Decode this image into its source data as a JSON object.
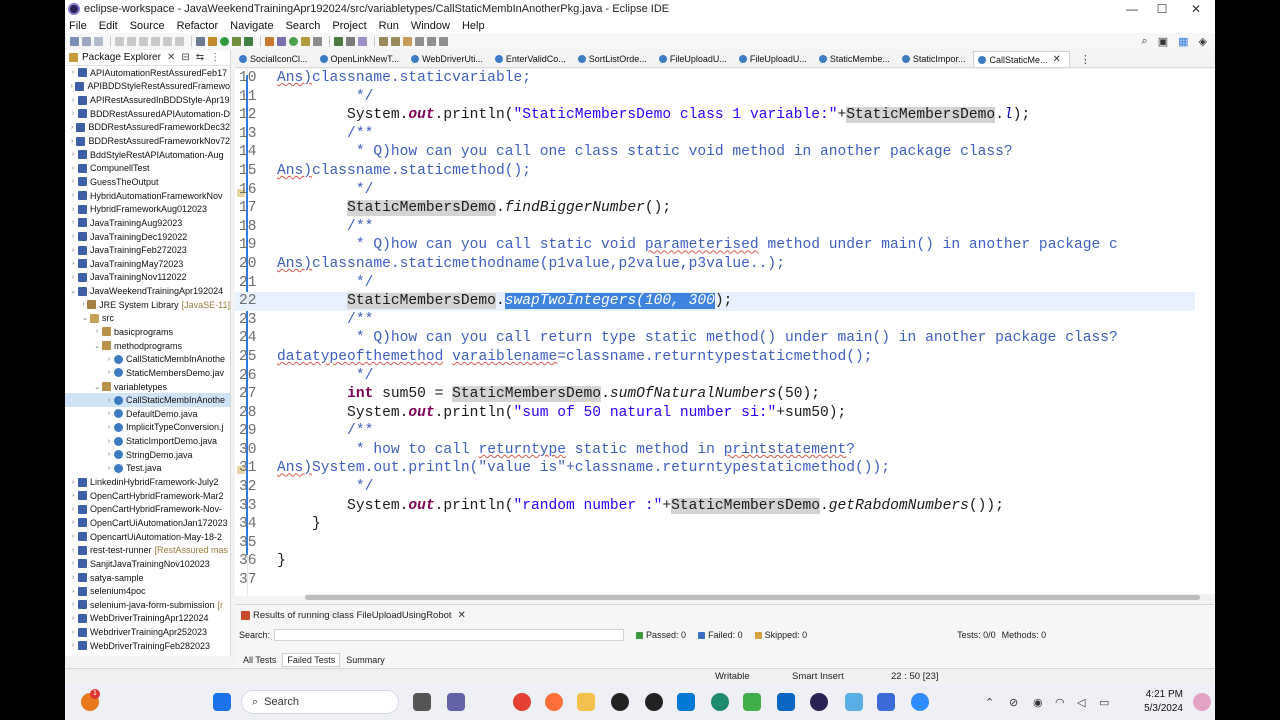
{
  "window": {
    "title": "eclipse-workspace - JavaWeekendTrainingApr192024/src/variabletypes/CallStaticMembInAnotherPkg.java - Eclipse IDE",
    "minimize": "—",
    "maximize": "☐",
    "close": "✕"
  },
  "menu": [
    "File",
    "Edit",
    "Source",
    "Refactor",
    "Navigate",
    "Search",
    "Project",
    "Run",
    "Window",
    "Help"
  ],
  "package_explorer": {
    "title": "Package Explorer",
    "items": [
      {
        "label": "APIAutomationRestAssuredFeb17",
        "type": "proj",
        "level": 0,
        "arrow": "›"
      },
      {
        "label": "APIBDDStyleRestAssuredFramewo",
        "type": "proj",
        "level": 0,
        "arrow": "›"
      },
      {
        "label": "APIRestAssuredInBDDStyle-Apr19",
        "type": "proj",
        "level": 0,
        "arrow": "›"
      },
      {
        "label": "BDDRestAssuredAPIAutomation-D",
        "type": "proj",
        "level": 0,
        "arrow": "›"
      },
      {
        "label": "BDDRestAssuredFrameworkDec32",
        "type": "proj",
        "level": 0,
        "arrow": "›"
      },
      {
        "label": "BDDRestAssuredFrameworkNov72",
        "type": "proj",
        "level": 0,
        "arrow": "›"
      },
      {
        "label": "BddStyleRestAPIAutomation-Aug",
        "type": "proj",
        "level": 0,
        "arrow": "›"
      },
      {
        "label": "CompunellTest",
        "type": "proj",
        "level": 0,
        "arrow": "›"
      },
      {
        "label": "GuessTheOutput",
        "type": "proj",
        "level": 0,
        "arrow": "›"
      },
      {
        "label": "HybridAutomationFrameworkNov",
        "type": "proj",
        "level": 0,
        "arrow": "›"
      },
      {
        "label": "HybridFrameworkAug012023",
        "type": "proj",
        "level": 0,
        "arrow": "›"
      },
      {
        "label": "JavaTrainingAug92023",
        "type": "proj",
        "level": 0,
        "arrow": "›"
      },
      {
        "label": "JavaTrainingDec192022",
        "type": "proj",
        "level": 0,
        "arrow": "›"
      },
      {
        "label": "JavaTrainingFeb272023",
        "type": "proj",
        "level": 0,
        "arrow": "›"
      },
      {
        "label": "JavaTrainingMay72023",
        "type": "proj",
        "level": 0,
        "arrow": "›"
      },
      {
        "label": "JavaTrainingNov112022",
        "type": "proj",
        "level": 0,
        "arrow": "›"
      },
      {
        "label": "JavaWeekendTrainingApr192024",
        "type": "proj",
        "level": 0,
        "arrow": "⌄"
      },
      {
        "label": "JRE System Library",
        "extra": "[JavaSE-11]",
        "type": "lib",
        "level": 1,
        "arrow": "›"
      },
      {
        "label": "src",
        "type": "src",
        "level": 1,
        "arrow": "⌄"
      },
      {
        "label": "basicprograms",
        "type": "pkg",
        "level": 2,
        "arrow": "›"
      },
      {
        "label": "methodprograms",
        "type": "pkg",
        "level": 2,
        "arrow": "⌄"
      },
      {
        "label": "CallStaticMembInAnothe",
        "type": "java",
        "level": 3,
        "arrow": "›"
      },
      {
        "label": "StaticMembersDemo.jav",
        "type": "java",
        "level": 3,
        "arrow": "›"
      },
      {
        "label": "variabletypes",
        "type": "pkg",
        "level": 2,
        "arrow": "⌄"
      },
      {
        "label": "CallStaticMembInAnothe",
        "type": "java",
        "level": 3,
        "arrow": "›",
        "selected": true
      },
      {
        "label": "DefaultDemo.java",
        "type": "java",
        "level": 3,
        "arrow": "›"
      },
      {
        "label": "ImplicitTypeConversion.j",
        "type": "java",
        "level": 3,
        "arrow": "›"
      },
      {
        "label": "StaticImportDemo.java",
        "type": "java",
        "level": 3,
        "arrow": "›"
      },
      {
        "label": "StringDemo.java",
        "type": "java",
        "level": 3,
        "arrow": "›"
      },
      {
        "label": "Test.java",
        "type": "java",
        "level": 3,
        "arrow": "›"
      },
      {
        "label": "LinkedinHybridFramework-July2",
        "type": "proj",
        "level": 0,
        "arrow": "›"
      },
      {
        "label": "OpenCartHybridFramework-Mar2",
        "type": "proj",
        "level": 0,
        "arrow": "›"
      },
      {
        "label": "OpenCartHybridFramework-Nov-",
        "type": "proj",
        "level": 0,
        "arrow": "›"
      },
      {
        "label": "OpenCartUiAutomationJan172023",
        "type": "proj",
        "level": 0,
        "arrow": "›"
      },
      {
        "label": "OpencartUiAutomation-May-18-2",
        "type": "proj",
        "level": 0,
        "arrow": "›"
      },
      {
        "label": "rest-test-runner",
        "extra": "[RestAssured mas",
        "type": "proj",
        "level": 0,
        "arrow": "›"
      },
      {
        "label": "SanjitJavaTrainingNov102023",
        "type": "proj",
        "level": 0,
        "arrow": "›"
      },
      {
        "label": "satya-sample",
        "type": "proj",
        "level": 0,
        "arrow": "›"
      },
      {
        "label": "selenium4poc",
        "type": "proj",
        "level": 0,
        "arrow": "›"
      },
      {
        "label": "selenium-java-form-submission",
        "extra": "[r",
        "type": "proj",
        "level": 0,
        "arrow": "›"
      },
      {
        "label": "WebDriverTrainingApr122024",
        "type": "proj",
        "level": 0,
        "arrow": "›"
      },
      {
        "label": "WebdriverTrainingApr252023",
        "type": "proj",
        "level": 0,
        "arrow": "›"
      },
      {
        "label": "WebDriverTrainingFeb282023",
        "type": "proj",
        "level": 0,
        "arrow": "›"
      }
    ]
  },
  "editor_tabs": [
    {
      "label": "SocialIconCl..."
    },
    {
      "label": "OpenLinkNewT..."
    },
    {
      "label": "WebDriverUti..."
    },
    {
      "label": "EnterValidCo..."
    },
    {
      "label": "SortListOrde..."
    },
    {
      "label": "FileUploadU..."
    },
    {
      "label": "FileUploadU..."
    },
    {
      "label": "StaticMembe..."
    },
    {
      "label": "StaticImpor..."
    },
    {
      "label": "CallStaticMe...",
      "active": true
    }
  ],
  "code_lines": [
    {
      "n": "10",
      "segs": [
        [
          "Ans)",
          "cm sq"
        ],
        [
          "classname.staticvariable;",
          "cm"
        ]
      ]
    },
    {
      "n": "11",
      "segs": [
        [
          "         */",
          "cm"
        ]
      ]
    },
    {
      "n": "12",
      "segs": [
        [
          "        System.",
          ""
        ],
        [
          "out",
          "kw it"
        ],
        [
          ".println(",
          ""
        ],
        [
          "\"StaticMembersDemo class 1 variable:\"",
          "st"
        ],
        [
          "+",
          ""
        ],
        [
          "StaticMembersDemo",
          "occ"
        ],
        [
          ".",
          ""
        ],
        [
          "l",
          "cn"
        ],
        [
          ");",
          ""
        ]
      ]
    },
    {
      "n": "13",
      "segs": [
        [
          "        /**",
          "cm"
        ]
      ]
    },
    {
      "n": "14",
      "segs": [
        [
          "         * Q)how can you call one class static void method in another package class?",
          "cm"
        ]
      ]
    },
    {
      "n": "15",
      "segs": [
        [
          "Ans)",
          "cm sq"
        ],
        [
          "classname.staticmethod();",
          "cm"
        ]
      ]
    },
    {
      "n": "16",
      "segs": [
        [
          "         */",
          "cm"
        ]
      ]
    },
    {
      "n": "17",
      "segs": [
        [
          "        ",
          ""
        ],
        [
          "StaticMembersDemo",
          "occ"
        ],
        [
          ".",
          ""
        ],
        [
          "findBiggerNumber",
          "it"
        ],
        [
          "();",
          ""
        ]
      ]
    },
    {
      "n": "18",
      "segs": [
        [
          "        /**",
          "cm"
        ]
      ]
    },
    {
      "n": "19",
      "segs": [
        [
          "         * Q)how can you call static void ",
          "cm"
        ],
        [
          "parameterised",
          "cm sq"
        ],
        [
          " method under main() in another package c",
          "cm"
        ]
      ]
    },
    {
      "n": "20",
      "segs": [
        [
          "Ans)",
          "cm sq"
        ],
        [
          "classname.staticmethodname(p1value,p2value,p3value..);",
          "cm"
        ]
      ]
    },
    {
      "n": "21",
      "segs": [
        [
          "         */",
          "cm"
        ]
      ]
    },
    {
      "n": "22",
      "cur": true,
      "segs": [
        [
          "        ",
          ""
        ],
        [
          "StaticMembersDemo",
          "occ"
        ],
        [
          ".",
          ""
        ],
        [
          "swapTwoIntegers(100, 300",
          "selt"
        ],
        [
          ");",
          ""
        ]
      ]
    },
    {
      "n": "23",
      "segs": [
        [
          "        /**",
          "cm"
        ]
      ]
    },
    {
      "n": "24",
      "segs": [
        [
          "         * Q)how can you call return type static method() under main() in another package class?",
          "cm"
        ]
      ]
    },
    {
      "n": "25",
      "segs": [
        [
          "datatypeofthemethod",
          "cm sq"
        ],
        [
          " ",
          "cm"
        ],
        [
          "varaiblename",
          "cm sq"
        ],
        [
          "=classname.returntypestaticmethod();",
          "cm"
        ]
      ]
    },
    {
      "n": "26",
      "segs": [
        [
          "         */",
          "cm"
        ]
      ]
    },
    {
      "n": "27",
      "segs": [
        [
          "        ",
          ""
        ],
        [
          "int",
          "kw"
        ],
        [
          " sum50 = ",
          ""
        ],
        [
          "StaticMembersDemo",
          "occ"
        ],
        [
          ".",
          ""
        ],
        [
          "sumOfNaturalNumbers",
          "it"
        ],
        [
          "(50);",
          ""
        ]
      ]
    },
    {
      "n": "28",
      "segs": [
        [
          "        System.",
          ""
        ],
        [
          "out",
          "kw it"
        ],
        [
          ".println(",
          ""
        ],
        [
          "\"sum of 50 natural number si:\"",
          "st"
        ],
        [
          "+sum50);",
          ""
        ]
      ]
    },
    {
      "n": "29",
      "segs": [
        [
          "        /**",
          "cm"
        ]
      ]
    },
    {
      "n": "30",
      "segs": [
        [
          "         * how to call ",
          "cm"
        ],
        [
          "returntype",
          "cm sq"
        ],
        [
          " static method in ",
          "cm"
        ],
        [
          "printstatement",
          "cm sq"
        ],
        [
          "?",
          "cm"
        ]
      ]
    },
    {
      "n": "31",
      "segs": [
        [
          "Ans)",
          "cm sq"
        ],
        [
          "System.out.println(\"value is\"+classname.returntypestaticmethod());",
          "cm"
        ]
      ]
    },
    {
      "n": "32",
      "segs": [
        [
          "         */",
          "cm"
        ]
      ]
    },
    {
      "n": "33",
      "segs": [
        [
          "        System.",
          ""
        ],
        [
          "out",
          "kw it"
        ],
        [
          ".println(",
          ""
        ],
        [
          "\"random number :\"",
          "st"
        ],
        [
          "+",
          ""
        ],
        [
          "StaticMembersDemo",
          "occ"
        ],
        [
          ".",
          ""
        ],
        [
          "getRabdomNumbers",
          "it"
        ],
        [
          "());",
          ""
        ]
      ]
    },
    {
      "n": "34",
      "segs": [
        [
          "    }",
          ""
        ]
      ]
    },
    {
      "n": "35",
      "segs": [
        [
          "",
          ""
        ]
      ]
    },
    {
      "n": "36",
      "segs": [
        [
          "}",
          ""
        ]
      ]
    },
    {
      "n": "37",
      "segs": [
        [
          "",
          ""
        ]
      ]
    }
  ],
  "test_panel": {
    "tab_title": "Results of running class FileUploadUsingRobot",
    "search_label": "Search:",
    "passed": "Passed: 0",
    "failed": "Failed: 0",
    "skipped": "Skipped: 0",
    "tests": "Tests: 0/0",
    "methods": "Methods: 0",
    "tabs": [
      "All Tests",
      "Failed Tests",
      "Summary"
    ]
  },
  "status_bar": {
    "writable": "Writable",
    "insert_mode": "Smart Insert",
    "position": "22 : 50 [23]"
  },
  "taskbar": {
    "search_placeholder": "Search",
    "time": "4:21 PM",
    "date": "5/3/2024",
    "notification_count": "1"
  },
  "colors": {
    "comment": "#3f5fbf",
    "keyword": "#7f0055",
    "string": "#2a00ff",
    "selection": "#3e83dd",
    "current_line": "#e8f2fe"
  }
}
